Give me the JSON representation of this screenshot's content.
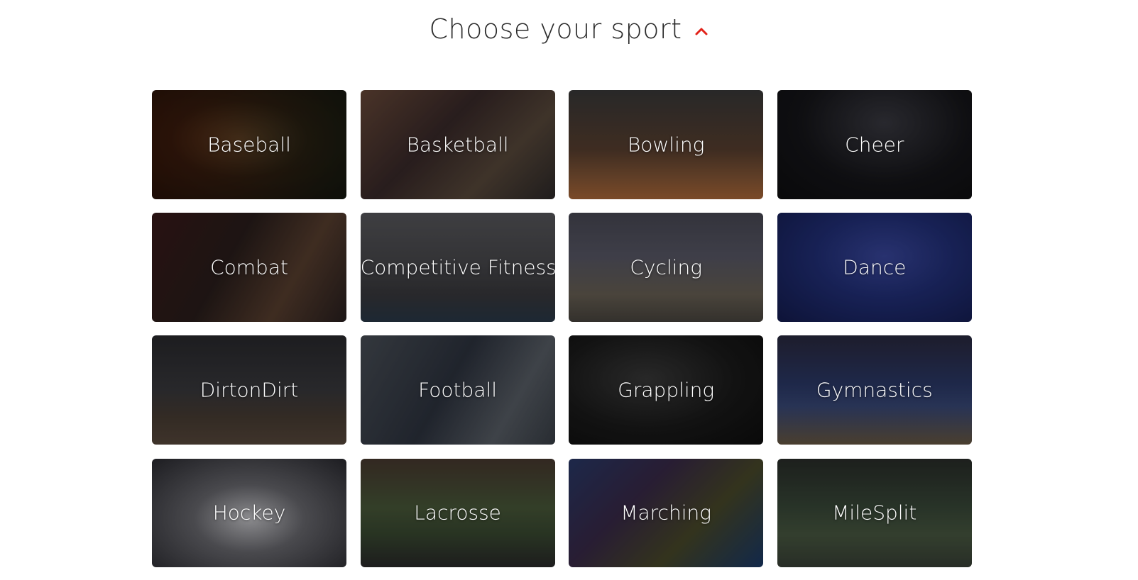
{
  "header": {
    "title": "Choose your sport",
    "toggle_icon": "chevron-up-icon",
    "accent_color": "#e2231a"
  },
  "sports": [
    {
      "label": "Baseball",
      "slug": "baseball"
    },
    {
      "label": "Basketball",
      "slug": "basketball"
    },
    {
      "label": "Bowling",
      "slug": "bowling"
    },
    {
      "label": "Cheer",
      "slug": "cheer"
    },
    {
      "label": "Combat",
      "slug": "combat"
    },
    {
      "label": "Competitive Fitness",
      "slug": "fitness"
    },
    {
      "label": "Cycling",
      "slug": "cycling"
    },
    {
      "label": "Dance",
      "slug": "dance"
    },
    {
      "label": "DirtonDirt",
      "slug": "dirt"
    },
    {
      "label": "Football",
      "slug": "football"
    },
    {
      "label": "Grappling",
      "slug": "grappling"
    },
    {
      "label": "Gymnastics",
      "slug": "gymnastics"
    },
    {
      "label": "Hockey",
      "slug": "hockey"
    },
    {
      "label": "Lacrosse",
      "slug": "lacrosse"
    },
    {
      "label": "Marching",
      "slug": "marching"
    },
    {
      "label": "MileSplit",
      "slug": "milesplit"
    }
  ]
}
